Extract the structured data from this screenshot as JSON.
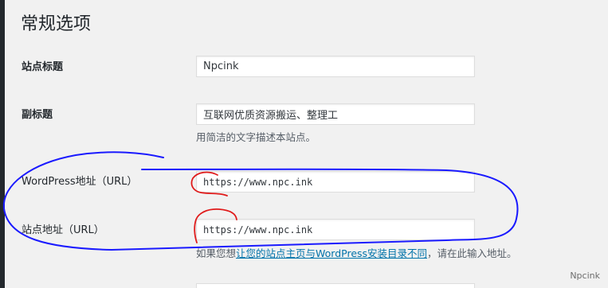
{
  "page": {
    "title": "常规选项"
  },
  "fields": {
    "site_title": {
      "label": "站点标题",
      "value": "Npcink"
    },
    "tagline": {
      "label": "副标题",
      "value": "互联网优质资源搬运、整理工",
      "description": "用简洁的文字描述本站点。"
    },
    "wordpress_address": {
      "label": "WordPress地址（URL）",
      "value": "https://www.npc.ink"
    },
    "site_address": {
      "label": "站点地址（URL）",
      "value": "https://www.npc.ink",
      "description_prefix": "如果您想",
      "description_link": "让您的站点主页与WordPress安装目录不同",
      "description_suffix": "，请在此输入地址。"
    }
  },
  "watermark": "Npcink",
  "colors": {
    "background": "#f1f1f1",
    "link": "#0073aa",
    "annotation_blue": "#1a1aff",
    "annotation_red": "#e01b1b"
  }
}
